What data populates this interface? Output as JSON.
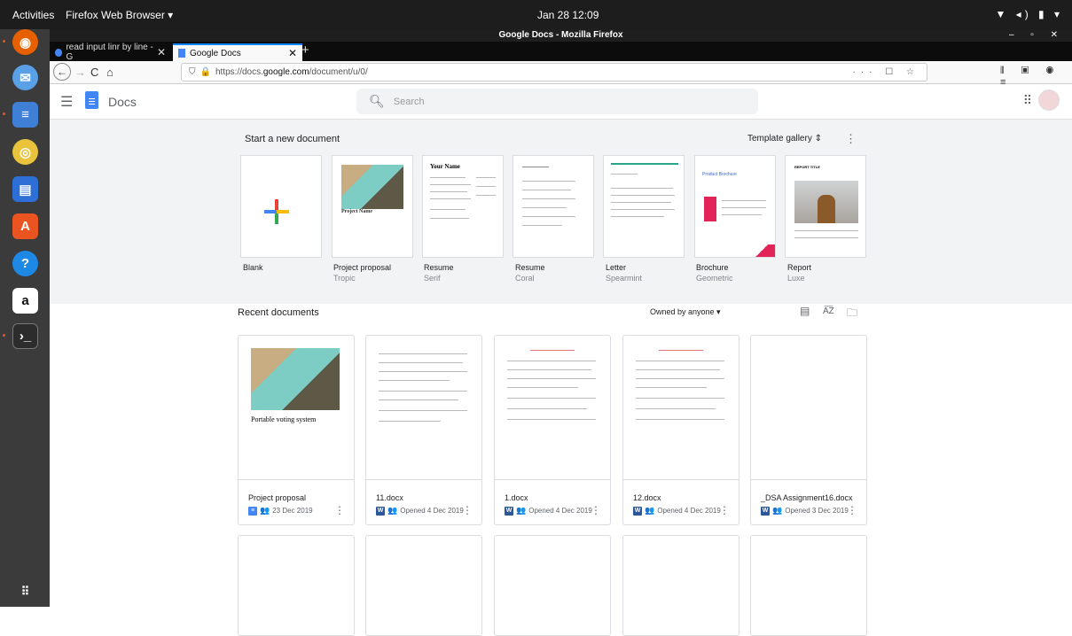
{
  "topbar": {
    "activities": "Activities",
    "app_menu": "Firefox Web Browser ▾",
    "clock": "Jan 28  12:09",
    "system_icons": "▼ ◂) ▮ ▾"
  },
  "window": {
    "title": "Google Docs - Mozilla Firefox",
    "controls": "– ▫ ✕"
  },
  "tabs": [
    {
      "label": "read input linr by line - G",
      "close": "✕"
    },
    {
      "label": "Google Docs",
      "close": "✕"
    }
  ],
  "new_tab": "+",
  "nav": {
    "back": "←",
    "forward": "→",
    "reload": "C",
    "home": "⌂",
    "url_prefix": "https://docs.",
    "url_domain": "google.com",
    "url_suffix": "/document/u/0/",
    "page_actions": "··· ☐ ☆",
    "toolbar_right": "⫴ ▣ ◉ ≡"
  },
  "docs": {
    "title": "Docs",
    "search_placeholder": "Search"
  },
  "new_section": {
    "heading": "Start a new document",
    "template_gallery": "Template gallery ⇕"
  },
  "templates": [
    {
      "name": "Blank",
      "sub": ""
    },
    {
      "name": "Project proposal",
      "sub": "Tropic"
    },
    {
      "name": "Resume",
      "sub": "Serif"
    },
    {
      "name": "Resume",
      "sub": "Coral"
    },
    {
      "name": "Letter",
      "sub": "Spearmint"
    },
    {
      "name": "Brochure",
      "sub": "Geometric"
    },
    {
      "name": "Report",
      "sub": "Luxe"
    }
  ],
  "template_text": {
    "your_name": "Your Name",
    "project_name": "Project Name",
    "product_brochure": "Product Brochure",
    "report_title": "REPORT TITLE"
  },
  "recent": {
    "heading": "Recent documents",
    "owner_filter": "Owned by anyone ▾"
  },
  "recent_docs": [
    {
      "name": "Project proposal",
      "meta": "23 Dec 2019",
      "icon": "docs",
      "preview_title": "Portable voting system"
    },
    {
      "name": "11.docx",
      "meta": "Opened 4 Dec 2019",
      "icon": "word"
    },
    {
      "name": "1.docx",
      "meta": "Opened 4 Dec 2019",
      "icon": "word"
    },
    {
      "name": "12.docx",
      "meta": "Opened 4 Dec 2019",
      "icon": "word"
    },
    {
      "name": "_DSA Assignment16.docx",
      "meta": "Opened 3 Dec 2019",
      "icon": "word"
    }
  ],
  "colors": {
    "docs_blue": "#4285f4",
    "word_blue": "#2b579a",
    "firefox_blue": "#0a84ff",
    "ubuntu_orange": "#e95420"
  }
}
